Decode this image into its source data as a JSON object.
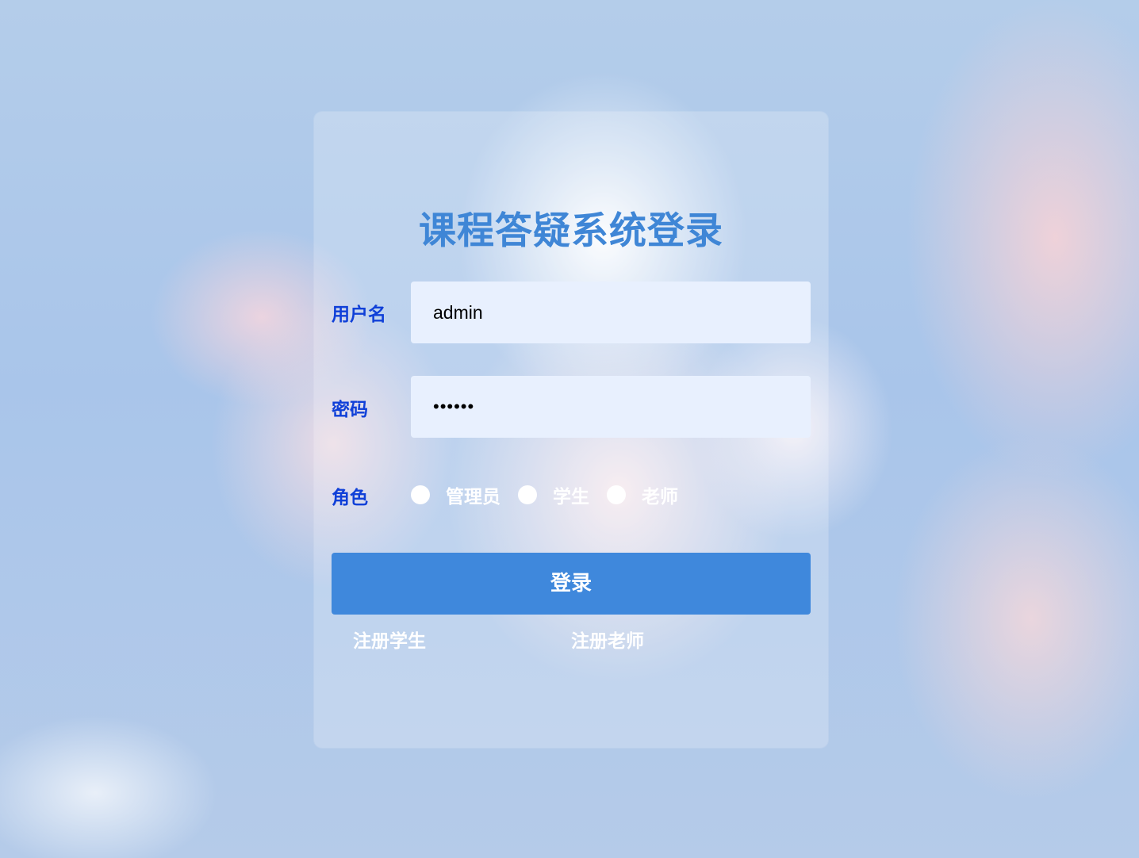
{
  "login": {
    "title": "课程答疑系统登录",
    "username_label": "用户名",
    "username_value": "admin",
    "password_label": "密码",
    "password_value": "••••••",
    "role_label": "角色",
    "roles": [
      {
        "label": "管理员"
      },
      {
        "label": "学生"
      },
      {
        "label": "老师"
      }
    ],
    "submit_label": "登录",
    "register_student_label": "注册学生",
    "register_teacher_label": "注册老师"
  },
  "colors": {
    "accent": "#3f88dc",
    "label": "#1040d8",
    "input_bg": "#e8f0fe"
  }
}
